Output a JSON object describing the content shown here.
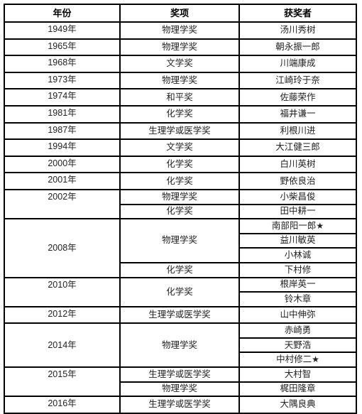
{
  "table": {
    "headers": [
      "年份",
      "奖项",
      "获奖者"
    ],
    "rows": [
      {
        "year": "1949年",
        "year_span": 1,
        "year_align": "top",
        "prize": "物理学奖",
        "prize_span": 1,
        "name": "汤川秀树",
        "star": false
      },
      {
        "year": "1965年",
        "year_span": 1,
        "year_align": "top",
        "prize": "物理学奖",
        "prize_span": 1,
        "name": "朝永振一郎",
        "star": false
      },
      {
        "year": "1968年",
        "year_span": 1,
        "year_align": "top",
        "prize": "文学奖",
        "prize_span": 1,
        "name": "川端康成",
        "star": false
      },
      {
        "year": "1973年",
        "year_span": 1,
        "year_align": "top",
        "prize": "物理学奖",
        "prize_span": 1,
        "name": "江崎玲于奈",
        "star": false
      },
      {
        "year": "1974年",
        "year_span": 1,
        "year_align": "top",
        "prize": "和平奖",
        "prize_span": 1,
        "name": "佐藤荣作",
        "star": false
      },
      {
        "year": "1981年",
        "year_span": 1,
        "year_align": "top",
        "prize": "化学奖",
        "prize_span": 1,
        "name": "福井谦一",
        "star": false
      },
      {
        "year": "1987年",
        "year_span": 1,
        "year_align": "top",
        "prize": "生理学或医学奖",
        "prize_span": 1,
        "name": "利根川进",
        "star": false
      },
      {
        "year": "1994年",
        "year_span": 1,
        "year_align": "top",
        "prize": "文学奖",
        "prize_span": 1,
        "name": "大江健三郎",
        "star": false
      },
      {
        "year": "2000年",
        "year_span": 1,
        "year_align": "top",
        "prize": "化学奖",
        "prize_span": 1,
        "name": "白川英树",
        "star": false
      },
      {
        "year": "2001年",
        "year_span": 1,
        "year_align": "top",
        "prize": "化学奖",
        "prize_span": 1,
        "name": "野依良治",
        "star": false
      },
      {
        "year": "2002年",
        "year_span": 2,
        "year_align": "top",
        "prize": "物理学奖",
        "prize_span": 1,
        "name": "小柴昌俊",
        "star": false
      },
      {
        "year": null,
        "year_span": 0,
        "year_align": "top",
        "prize": "化学奖",
        "prize_span": 1,
        "name": "田中耕一",
        "star": false
      },
      {
        "year": "2008年",
        "year_span": 4,
        "year_align": "middle",
        "prize": "物理学奖",
        "prize_span": 3,
        "name": "南部阳一郎",
        "star": true
      },
      {
        "year": null,
        "year_span": 0,
        "year_align": "top",
        "prize": null,
        "prize_span": 0,
        "name": "益川敏英",
        "star": false
      },
      {
        "year": null,
        "year_span": 0,
        "year_align": "top",
        "prize": null,
        "prize_span": 0,
        "name": "小林诚",
        "star": false
      },
      {
        "year": null,
        "year_span": 0,
        "year_align": "top",
        "prize": "化学奖",
        "prize_span": 1,
        "name": "下村修",
        "star": false
      },
      {
        "year": "2010年",
        "year_span": 2,
        "year_align": "top",
        "prize": "化学奖",
        "prize_span": 2,
        "name": "根岸英一",
        "star": false
      },
      {
        "year": null,
        "year_span": 0,
        "year_align": "top",
        "prize": null,
        "prize_span": 0,
        "name": "铃木章",
        "star": false
      },
      {
        "year": "2012年",
        "year_span": 1,
        "year_align": "top",
        "prize": "生理学或医学奖",
        "prize_span": 1,
        "name": "山中伸弥",
        "star": false
      },
      {
        "year": "2014年",
        "year_span": 3,
        "year_align": "middle",
        "prize": "物理学奖",
        "prize_span": 3,
        "name": "赤崎勇",
        "star": false
      },
      {
        "year": null,
        "year_span": 0,
        "year_align": "top",
        "prize": null,
        "prize_span": 0,
        "name": "天野浩",
        "star": false
      },
      {
        "year": null,
        "year_span": 0,
        "year_align": "top",
        "prize": null,
        "prize_span": 0,
        "name": "中村修二",
        "star": true
      },
      {
        "year": "2015年",
        "year_span": 2,
        "year_align": "top",
        "prize": "生理学或医学奖",
        "prize_span": 1,
        "name": "大村智",
        "star": false
      },
      {
        "year": null,
        "year_span": 0,
        "year_align": "top",
        "prize": "物理学奖",
        "prize_span": 1,
        "name": "梶田隆章",
        "star": false
      },
      {
        "year": "2016年",
        "year_span": 1,
        "year_align": "top",
        "prize": "生理学或医学奖",
        "prize_span": 1,
        "name": "大隅良典",
        "star": false
      }
    ],
    "star_glyph": "★"
  },
  "colors": {
    "border": "#000000",
    "text": "#222222",
    "header_text": "#000000",
    "background": "#ffffff"
  }
}
